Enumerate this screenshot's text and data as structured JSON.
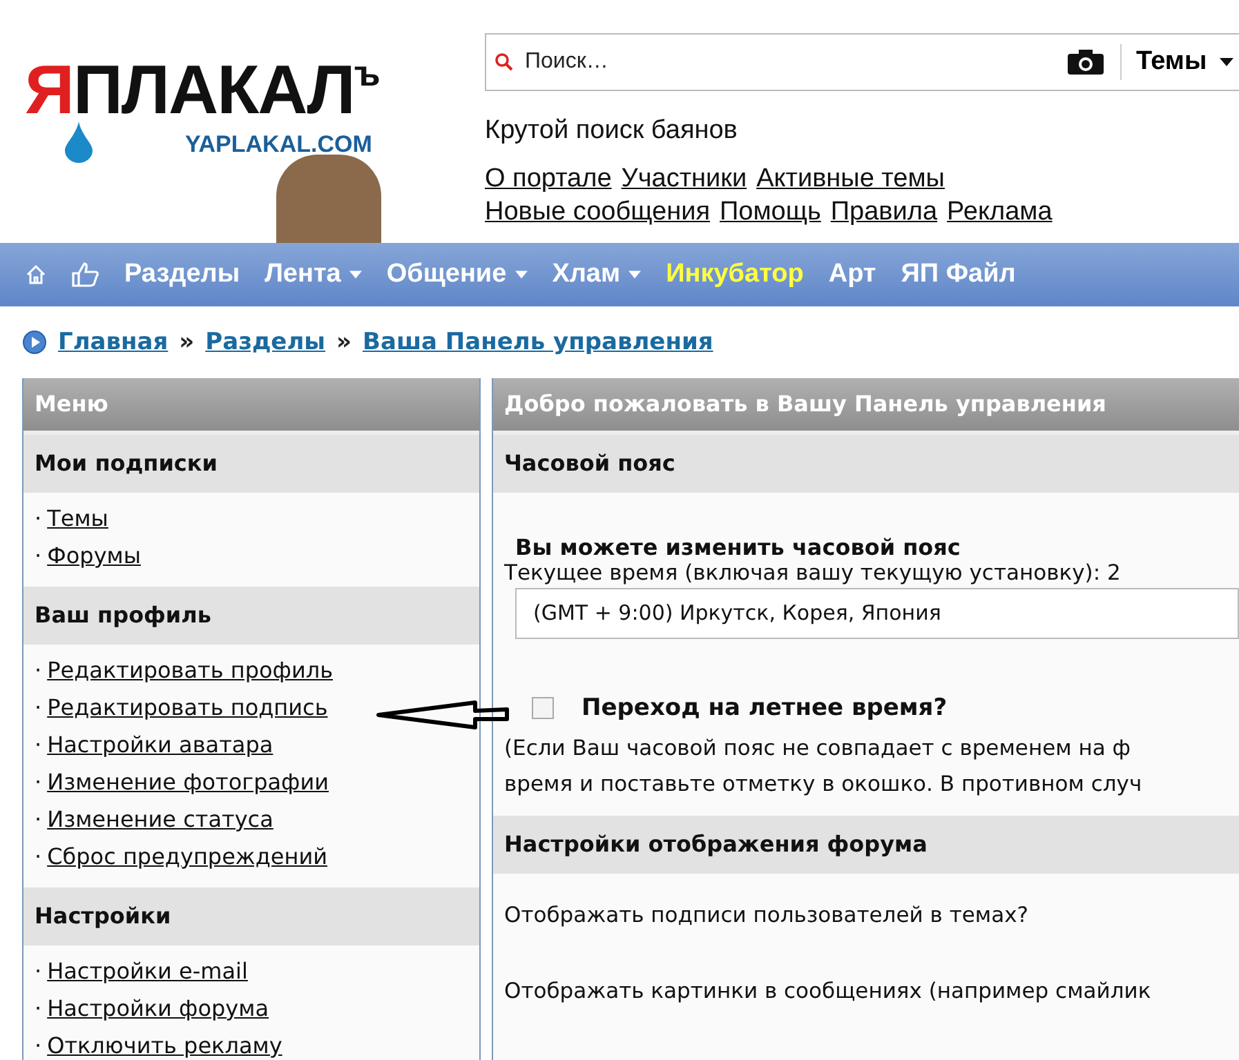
{
  "logo": {
    "first": "Я",
    "rest": "ПЛАКАЛ",
    "suffix": "ъ",
    "domain": "YAPLAKAL.COM"
  },
  "search": {
    "placeholder": "Поиск…",
    "scope": "Темы"
  },
  "tagline": "Крутой поиск баянов",
  "top_links": [
    [
      "О портале",
      "Участники",
      "Активные темы"
    ],
    [
      "Новые сообщения",
      "Помощь",
      "Правила",
      "Реклама"
    ]
  ],
  "nav": [
    {
      "label": "Разделы",
      "dropdown": false,
      "highlighted": false
    },
    {
      "label": "Лента",
      "dropdown": true,
      "highlighted": false
    },
    {
      "label": "Общение",
      "dropdown": true,
      "highlighted": false
    },
    {
      "label": "Хлам",
      "dropdown": true,
      "highlighted": false
    },
    {
      "label": "Инкубатор",
      "dropdown": false,
      "highlighted": true
    },
    {
      "label": "Арт",
      "dropdown": false,
      "highlighted": false
    },
    {
      "label": "ЯП Файл",
      "dropdown": false,
      "highlighted": false
    }
  ],
  "breadcrumb": [
    {
      "kind": "link",
      "text": "Главная"
    },
    {
      "kind": "separator",
      "text": "»"
    },
    {
      "kind": "link",
      "text": "Разделы"
    },
    {
      "kind": "separator",
      "text": "»"
    },
    {
      "kind": "link",
      "text": "Ваша Панель управления"
    }
  ],
  "sidebar": {
    "title": "Меню",
    "sections": [
      {
        "title": "Мои подписки",
        "items": [
          {
            "bullet": "·",
            "label": "Темы"
          },
          {
            "bullet": "·",
            "label": "Форумы"
          }
        ]
      },
      {
        "title": "Ваш профиль",
        "items": [
          {
            "bullet": "·",
            "label": "Редактировать профиль"
          },
          {
            "bullet": "·",
            "label": "Редактировать подпись"
          },
          {
            "bullet": "·",
            "label": "Настройки аватара"
          },
          {
            "bullet": "·",
            "label": "Изменение фотографии"
          },
          {
            "bullet": "·",
            "label": "Изменение статуса"
          },
          {
            "bullet": "·",
            "label": "Сброс предупреждений"
          }
        ]
      },
      {
        "title": "Настройки",
        "items": [
          {
            "bullet": "·",
            "label": "Настройки e-mail"
          },
          {
            "bullet": "·",
            "label": "Настройки форума"
          },
          {
            "bullet": "·",
            "label": "Отключить рекламу"
          }
        ]
      }
    ]
  },
  "main": {
    "title": "Добро пожаловать в Вашу Панель управления",
    "timezone": {
      "title": "Часовой пояс",
      "heading": "Вы можете изменить часовой пояс",
      "current_time": "Текущее время (включая вашу текущую установку): 2",
      "select_value": "(GMT + 9:00) Иркутск, Корея, Япония",
      "dst_label": "Переход на летнее время?",
      "dst_checked": false,
      "note_lines": [
        "(Если Ваш часовой пояс не совпадает с временем на ф",
        "время и поставьте отметку в окошко. В противном случ"
      ]
    },
    "display": {
      "title": "Настройки отображения форума",
      "questions": [
        "Отображать подписи пользователей в темах?",
        "Отображать картинки в сообщениях (например смайлик"
      ]
    }
  }
}
